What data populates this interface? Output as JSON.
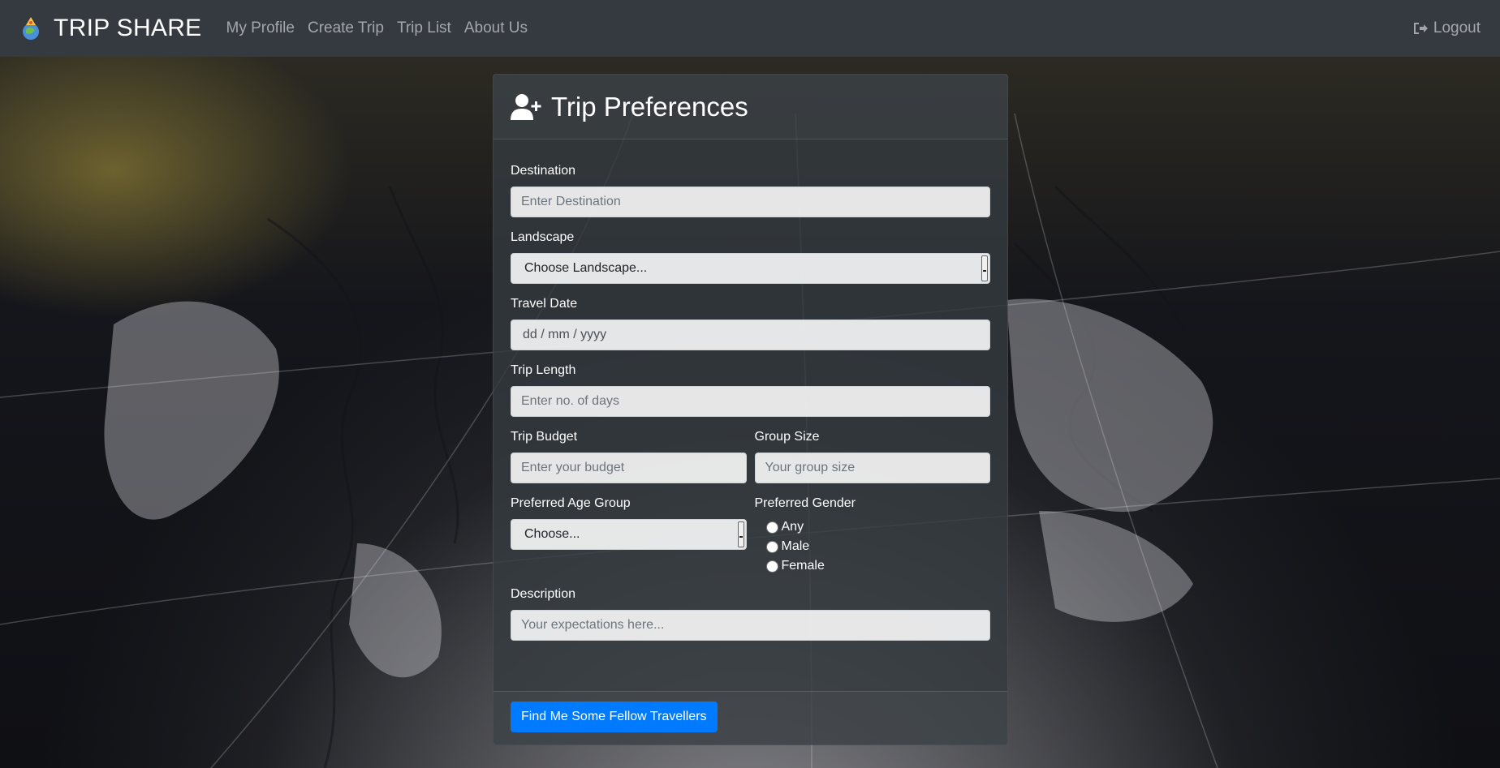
{
  "navbar": {
    "brand": "TRIP SHARE",
    "links": [
      "My Profile",
      "Create Trip",
      "Trip List",
      "About Us"
    ],
    "logout": "Logout"
  },
  "card": {
    "title": "Trip Preferences",
    "fields": {
      "destination": {
        "label": "Destination",
        "placeholder": "Enter Destination"
      },
      "landscape": {
        "label": "Landscape",
        "value": "Choose Landscape..."
      },
      "travel_date": {
        "label": "Travel Date",
        "value": "dd / mm / yyyy"
      },
      "trip_length": {
        "label": "Trip Length",
        "placeholder": "Enter no. of days"
      },
      "trip_budget": {
        "label": "Trip Budget",
        "placeholder": "Enter your budget"
      },
      "group_size": {
        "label": "Group Size",
        "placeholder": "Your group size"
      },
      "age_group": {
        "label": "Preferred Age Group",
        "value": "Choose..."
      },
      "gender": {
        "label": "Preferred Gender",
        "options": [
          "Any",
          "Male",
          "Female"
        ]
      },
      "description": {
        "label": "Description",
        "placeholder": "Your expectations here..."
      }
    },
    "submit": "Find Me Some Fellow Travellers"
  },
  "colors": {
    "navbar_bg": "#343a40",
    "primary": "#007bff"
  }
}
